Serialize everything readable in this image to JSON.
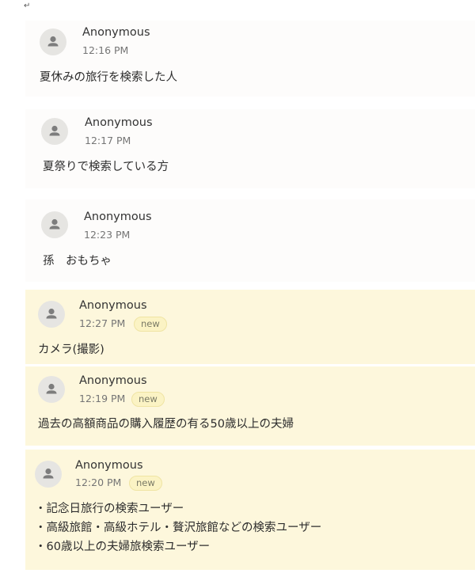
{
  "corner_mark": "↵",
  "comments": [
    {
      "author": "Anonymous",
      "time": "12:16 PM",
      "badge": "",
      "lines": [
        "夏休みの旅行を検索した人"
      ]
    },
    {
      "author": "Anonymous",
      "time": "12:17 PM",
      "badge": "",
      "lines": [
        "夏祭りで検索している方"
      ]
    },
    {
      "author": "Anonymous",
      "time": "12:23 PM",
      "badge": "",
      "lines": [
        "孫　おもちゃ"
      ]
    },
    {
      "author": "Anonymous",
      "time": "12:27 PM",
      "badge": "new",
      "lines": [
        "カメラ(撮影)"
      ]
    },
    {
      "author": "Anonymous",
      "time": "12:19 PM",
      "badge": "new",
      "lines": [
        "過去の高額商品の購入履歴の有る50歳以上の夫婦"
      ]
    },
    {
      "author": "Anonymous",
      "time": "12:20 PM",
      "badge": "new",
      "lines": [
        "・記念日旅行の検索ユーザー",
        "・高級旅館・高級ホテル・贅沢旅館などの検索ユーザー",
        "・60歳以上の夫婦旅検索ユーザー"
      ]
    }
  ],
  "colors": {
    "new_card_background": "#fdf7dc",
    "card_background": "#fdfcfb",
    "badge_background": "#fbf3c4"
  },
  "icons": {
    "avatar": "person-icon"
  }
}
